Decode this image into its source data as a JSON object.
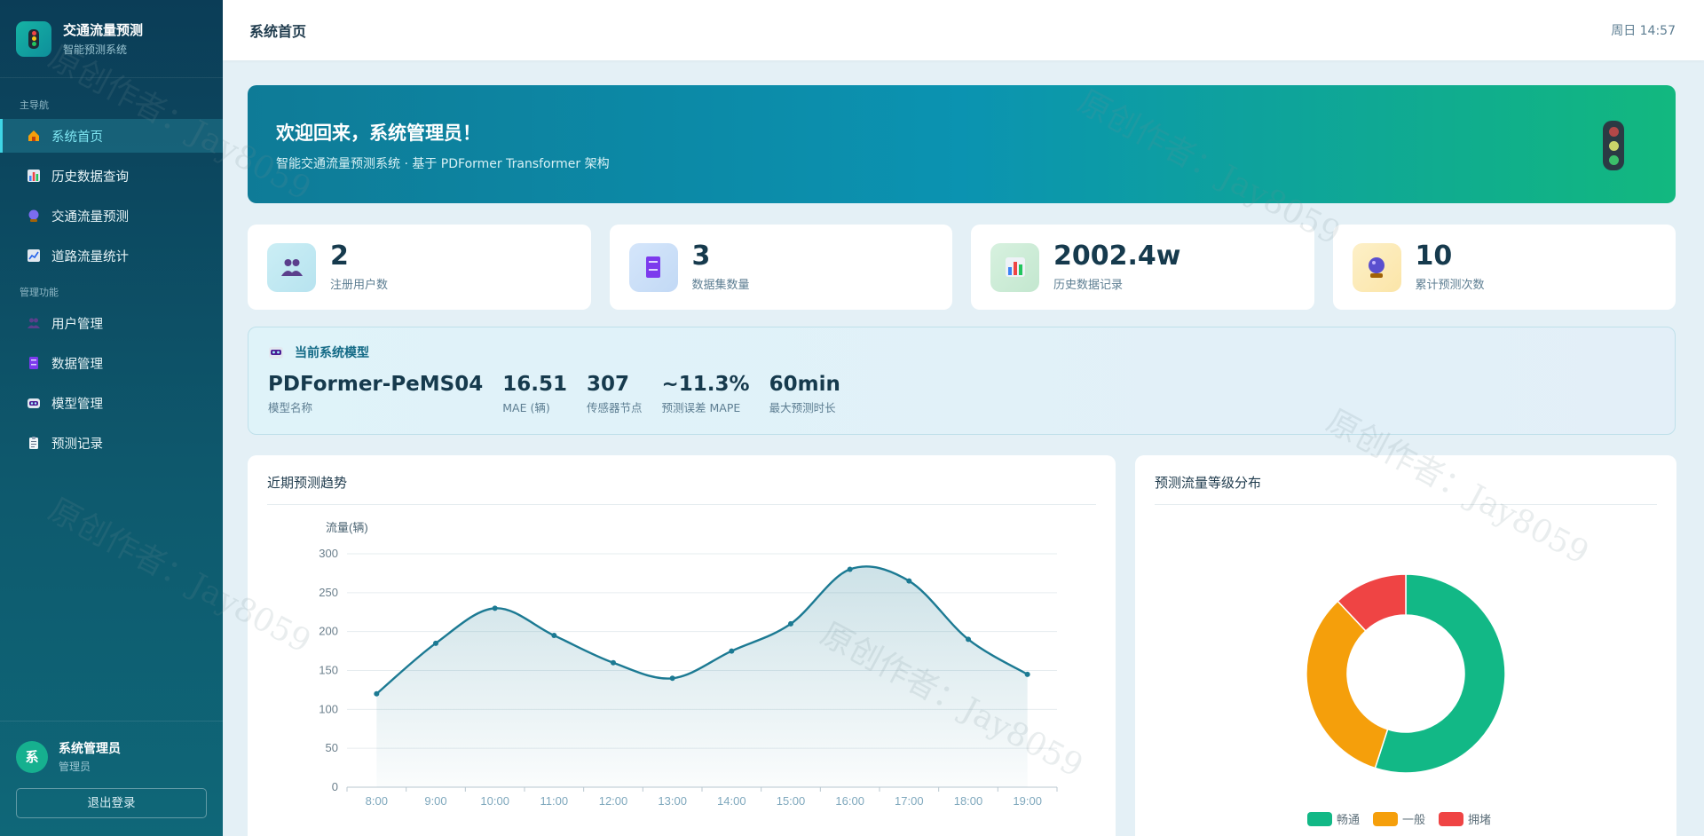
{
  "brand": {
    "title": "交通流量预测",
    "subtitle": "智能预测系统"
  },
  "nav": {
    "section_main": "主导航",
    "section_admin": "管理功能",
    "main_items": [
      {
        "label": "系统首页",
        "icon": "home-icon"
      },
      {
        "label": "历史数据查询",
        "icon": "bar-chart-icon"
      },
      {
        "label": "交通流量预测",
        "icon": "crystal-ball-icon"
      },
      {
        "label": "道路流量统计",
        "icon": "line-chart-icon"
      }
    ],
    "admin_items": [
      {
        "label": "用户管理",
        "icon": "users-icon"
      },
      {
        "label": "数据管理",
        "icon": "cabinet-icon"
      },
      {
        "label": "模型管理",
        "icon": "robot-icon"
      },
      {
        "label": "预测记录",
        "icon": "clipboard-icon"
      }
    ]
  },
  "user": {
    "avatar": "系",
    "name": "系统管理员",
    "role": "管理员",
    "logout": "退出登录"
  },
  "header": {
    "title": "系统首页",
    "clock": "周日 14:57"
  },
  "banner": {
    "title": "欢迎回来，系统管理员！",
    "subtitle": "智能交通流量预测系统 · 基于 PDFormer Transformer 架构"
  },
  "stats": [
    {
      "value": "2",
      "label": "注册用户数"
    },
    {
      "value": "3",
      "label": "数据集数量"
    },
    {
      "value": "2002.4w",
      "label": "历史数据记录"
    },
    {
      "value": "10",
      "label": "累计预测次数"
    }
  ],
  "model": {
    "heading": "当前系统模型",
    "items": [
      {
        "value": "PDFormer-PeMS04",
        "label": "模型名称"
      },
      {
        "value": "16.51",
        "label": "MAE (辆)"
      },
      {
        "value": "307",
        "label": "传感器节点"
      },
      {
        "value": "~11.3%",
        "label": "预测误差 MAPE"
      },
      {
        "value": "60min",
        "label": "最大预测时长"
      }
    ]
  },
  "trend_title": "近期预测趋势",
  "pie_title": "预测流量等级分布",
  "watermark": "原创作者：Jay8059",
  "colors": {
    "line": "#1c7a93",
    "free": "#12b886",
    "normal": "#f59f0b",
    "jam": "#ef4444"
  },
  "chart_data": [
    {
      "type": "area",
      "title": "近期预测趋势",
      "ylabel": "流量(辆)",
      "ylim": [
        0,
        300
      ],
      "yticks": [
        0,
        50,
        100,
        150,
        200,
        250,
        300
      ],
      "categories": [
        "8:00",
        "9:00",
        "10:00",
        "11:00",
        "12:00",
        "13:00",
        "14:00",
        "15:00",
        "16:00",
        "17:00",
        "18:00",
        "19:00"
      ],
      "values": [
        120,
        185,
        230,
        195,
        160,
        140,
        175,
        210,
        280,
        265,
        190,
        145
      ],
      "grid": true
    },
    {
      "type": "pie",
      "title": "预测流量等级分布",
      "donut": true,
      "legend": "bottom",
      "slices": [
        {
          "name": "畅通",
          "value": 55
        },
        {
          "name": "一般",
          "value": 33
        },
        {
          "name": "拥堵",
          "value": 12
        }
      ]
    }
  ]
}
